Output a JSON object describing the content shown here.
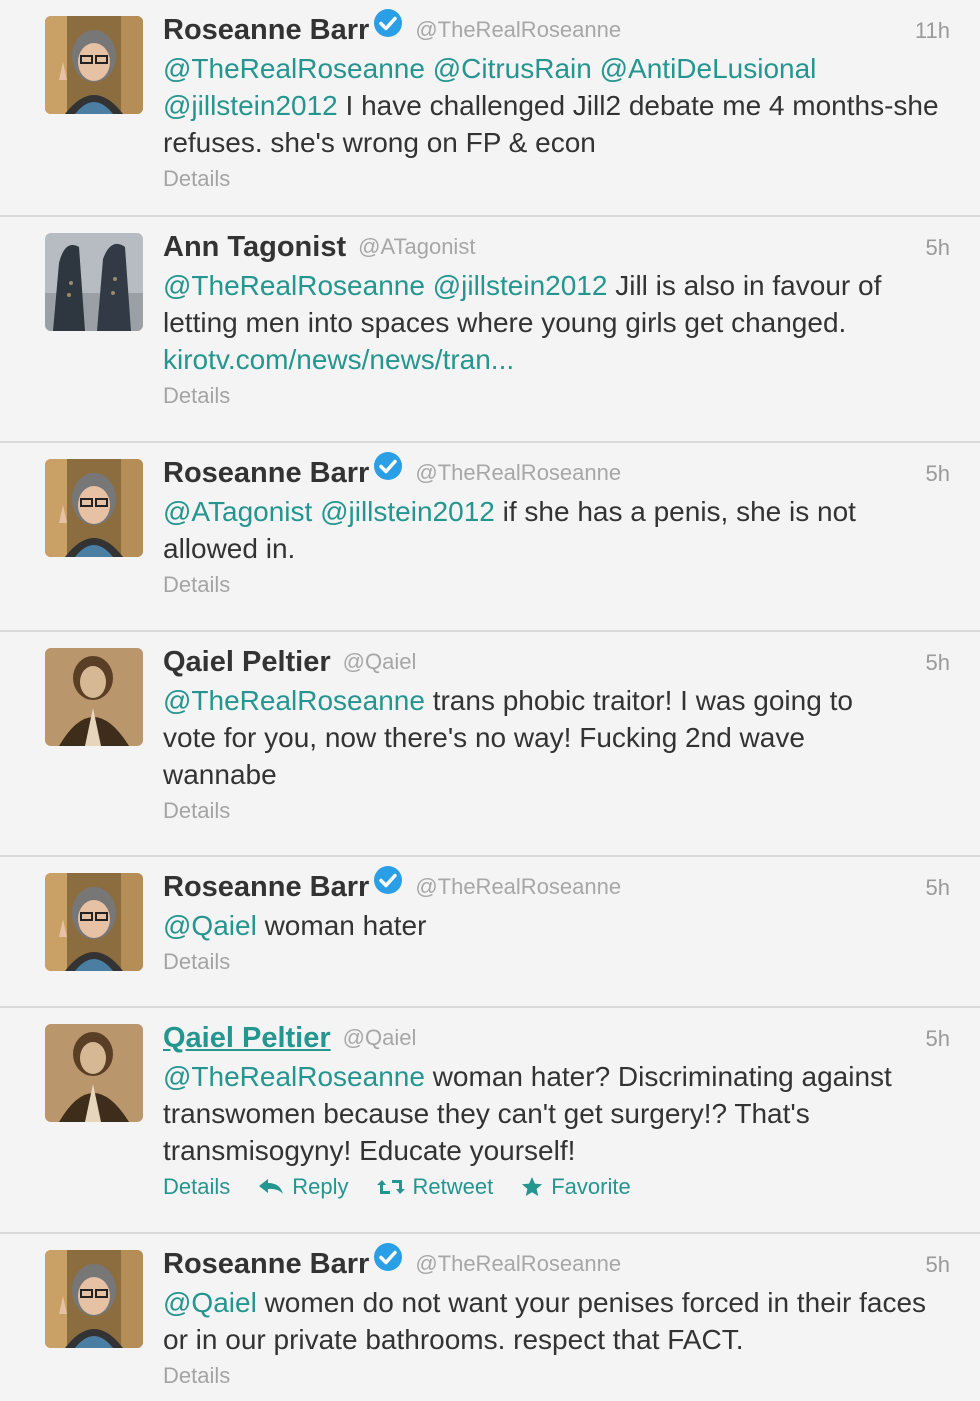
{
  "accent_color": "#25958f",
  "tweets": [
    {
      "name": "Roseanne Barr",
      "verified": true,
      "handle": "@TheRealRoseanne",
      "time": "11h",
      "segments": [
        {
          "t": "@TheRealRoseanne",
          "type": "mention"
        },
        {
          "t": " ",
          "type": "text"
        },
        {
          "t": "@CitrusRain",
          "type": "mention"
        },
        {
          "t": " ",
          "type": "text"
        },
        {
          "t": "@AntiDeLusional",
          "type": "mention"
        },
        {
          "t": " ",
          "type": "text"
        },
        {
          "t": "@jillstein2012",
          "type": "mention"
        },
        {
          "t": " I have challenged Jill2 debate me 4 months-she refuses. she's wrong on FP & econ",
          "type": "text"
        }
      ],
      "details": "Details"
    },
    {
      "name": "Ann Tagonist",
      "verified": false,
      "handle": "@ATagonist",
      "time": "5h",
      "segments": [
        {
          "t": "@TheRealRoseanne",
          "type": "mention"
        },
        {
          "t": " ",
          "type": "text"
        },
        {
          "t": "@jillstein2012",
          "type": "mention"
        },
        {
          "t": " Jill is also in favour of letting men into spaces where young girls get changed. ",
          "type": "text"
        },
        {
          "t": "kirotv.com/news/news/tran...",
          "type": "url"
        }
      ],
      "details": "Details"
    },
    {
      "name": "Roseanne Barr",
      "verified": true,
      "handle": "@TheRealRoseanne",
      "time": "5h",
      "segments": [
        {
          "t": "@ATagonist",
          "type": "mention"
        },
        {
          "t": " ",
          "type": "text"
        },
        {
          "t": "@jillstein2012",
          "type": "mention"
        },
        {
          "t": " if she has a penis, she is not allowed in.",
          "type": "text"
        }
      ],
      "details": "Details"
    },
    {
      "name": "Qaiel Peltier",
      "verified": false,
      "handle": "@Qaiel",
      "time": "5h",
      "segments": [
        {
          "t": "@TheRealRoseanne",
          "type": "mention"
        },
        {
          "t": " trans phobic traitor! I was going to vote for you, now there's no way! Fucking 2nd wave wannabe",
          "type": "text"
        }
      ],
      "details": "Details"
    },
    {
      "name": "Roseanne Barr",
      "verified": true,
      "handle": "@TheRealRoseanne",
      "time": "5h",
      "segments": [
        {
          "t": "@Qaiel",
          "type": "mention"
        },
        {
          "t": " woman hater",
          "type": "text"
        }
      ],
      "details": "Details"
    },
    {
      "name": "Qaiel Peltier",
      "verified": false,
      "handle": "@Qaiel",
      "time": "5h",
      "name_hover": true,
      "segments": [
        {
          "t": "@TheRealRoseanne",
          "type": "mention"
        },
        {
          "t": " woman hater? Discriminating against transwomen because they can't get surgery!? That's transmisogyny! Educate yourself!",
          "type": "text"
        }
      ],
      "details": "Details",
      "actions": {
        "reply": "Reply",
        "retweet": "Retweet",
        "favorite": "Favorite"
      }
    },
    {
      "name": "Roseanne Barr",
      "verified": true,
      "handle": "@TheRealRoseanne",
      "time": "5h",
      "segments": [
        {
          "t": "@Qaiel",
          "type": "mention"
        },
        {
          "t": " women do not want your penises forced in their faces or in our private bathrooms. respect that FACT.",
          "type": "text"
        }
      ],
      "details": "Details"
    }
  ]
}
